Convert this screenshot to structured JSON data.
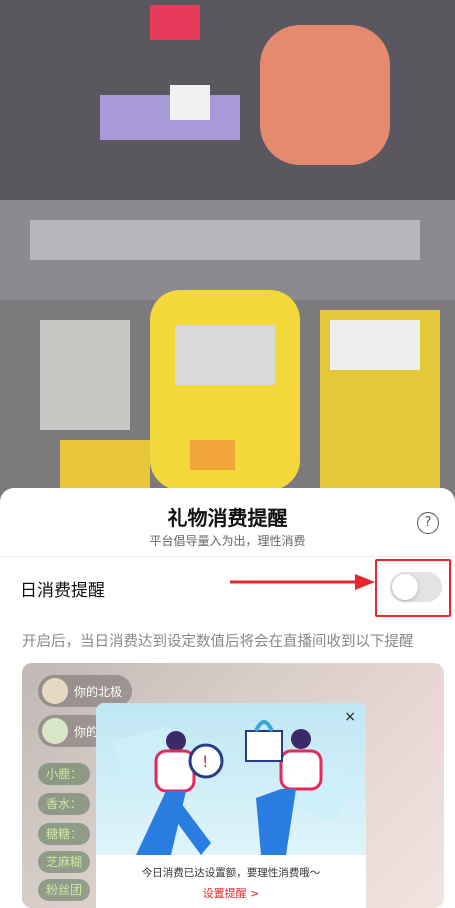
{
  "video": {
    "background": "#6d6a70"
  },
  "sheet": {
    "title": "礼物消费提醒",
    "subtitle": "平台倡导量入为出，理性消费",
    "help_icon": "?",
    "daily_reminder_label": "日消费提醒",
    "toggle_state": "off",
    "description": "开启后，当日消费达到设定数值后将会在直播间收到以下提醒"
  },
  "preview": {
    "chat": [
      {
        "text": "你的北极"
      },
      {
        "text": "你的"
      }
    ],
    "tags": [
      "小鹿：",
      "香水：",
      "糖糖：",
      "芝麻糊",
      "粉丝团"
    ],
    "popup": {
      "close": "×",
      "message": "今日消费已达设置额，要理性消费哦～",
      "link": "设置提醒 >"
    }
  },
  "colors": {
    "accent_red": "#e8262d",
    "toggle_off": "#e3e3e6"
  }
}
